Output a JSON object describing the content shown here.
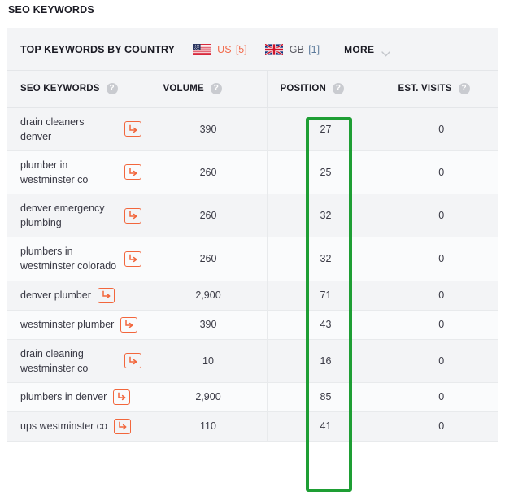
{
  "page": {
    "title": "SEO KEYWORDS"
  },
  "topbar": {
    "title": "TOP KEYWORDS BY COUNTRY",
    "countries": [
      {
        "code": "US",
        "count": "[5]",
        "flag": "us-flag-icon",
        "active": true
      },
      {
        "code": "GB",
        "count": "[1]",
        "flag": "gb-flag-icon",
        "active": false
      }
    ],
    "more_label": "MORE",
    "chevron_icon": "chevron-down-icon"
  },
  "table": {
    "columns": [
      {
        "label": "SEO KEYWORDS",
        "help_icon": "help-icon",
        "help_glyph": "?"
      },
      {
        "label": "VOLUME",
        "help_icon": "help-icon",
        "help_glyph": "?"
      },
      {
        "label": "POSITION",
        "help_icon": "help-icon",
        "help_glyph": "?"
      },
      {
        "label": "EST. VISITS",
        "help_icon": "help-icon",
        "help_glyph": "?"
      }
    ],
    "row_action_icon": "arrow-down-right-icon",
    "rows": [
      {
        "keyword": "drain cleaners denver",
        "volume": "390",
        "position": "27",
        "est_visits": "0"
      },
      {
        "keyword": "plumber in westminster co",
        "volume": "260",
        "position": "25",
        "est_visits": "0"
      },
      {
        "keyword": "denver emergency plumbing",
        "volume": "260",
        "position": "32",
        "est_visits": "0"
      },
      {
        "keyword": "plumbers in westminster colorado",
        "volume": "260",
        "position": "32",
        "est_visits": "0"
      },
      {
        "keyword": "denver plumber",
        "volume": "2,900",
        "position": "71",
        "est_visits": "0"
      },
      {
        "keyword": "westminster plumber",
        "volume": "390",
        "position": "43",
        "est_visits": "0"
      },
      {
        "keyword": "drain cleaning westminster co",
        "volume": "10",
        "position": "16",
        "est_visits": "0"
      },
      {
        "keyword": "plumbers in denver",
        "volume": "2,900",
        "position": "85",
        "est_visits": "0"
      },
      {
        "keyword": "ups westminster co",
        "volume": "110",
        "position": "41",
        "est_visits": "0"
      }
    ]
  },
  "annotation": {
    "highlight_color": "#1e9e34",
    "highlight_target": "position-column"
  },
  "colors": {
    "accent_orange": "#f2663c",
    "active_tab": "#f26b4d",
    "header_bg": "#f3f4f6",
    "row_alt_bg": "#fafbfc"
  }
}
